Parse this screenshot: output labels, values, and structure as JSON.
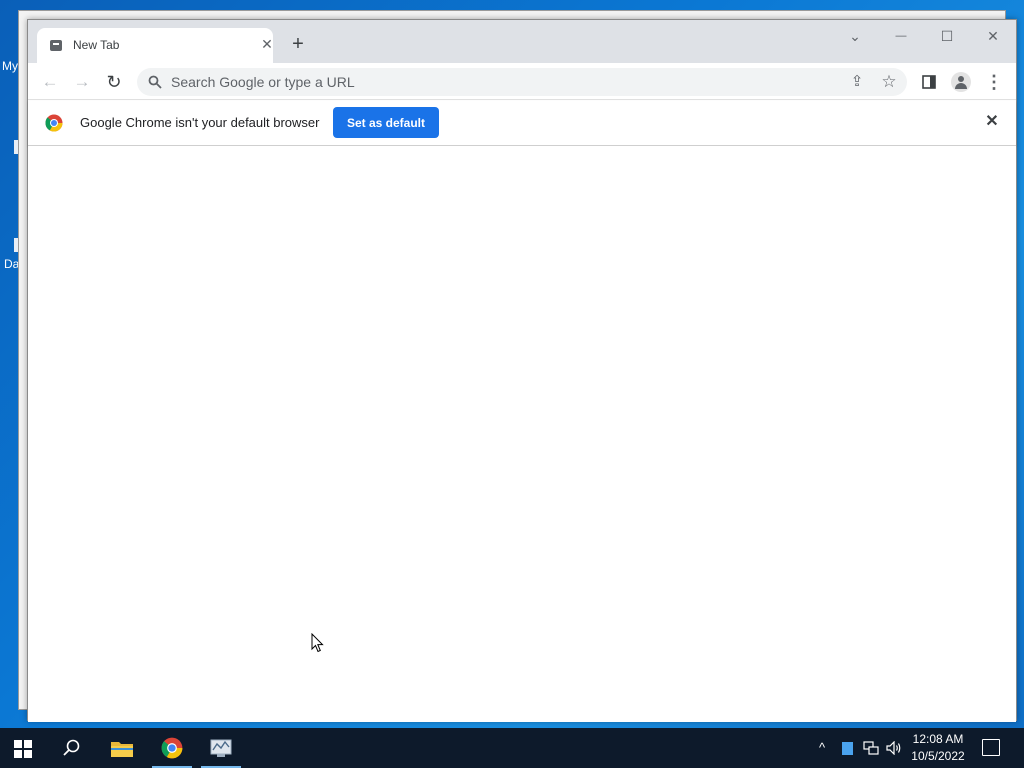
{
  "desktop": {
    "icon_labels": [
      "My",
      "Da"
    ]
  },
  "browser": {
    "tab": {
      "title": "New Tab",
      "close_icon": "close-icon"
    },
    "new_tab_label": "+",
    "window_controls": {
      "tab_search": "⌄",
      "minimize": "—",
      "maximize": "☐",
      "close": "✕"
    },
    "toolbar": {
      "back": "←",
      "forward": "→",
      "reload": "↻",
      "omnibox_placeholder": "Search Google or type a URL",
      "omnibox_value": "",
      "share": "⇪",
      "bookmark": "☆",
      "side_panel": "▮",
      "menu": "⋮"
    },
    "infobar": {
      "message": "Google Chrome isn't your default browser",
      "button_label": "Set as default",
      "close": "✕"
    }
  },
  "taskbar": {
    "apps": [
      "file-explorer",
      "google-chrome",
      "network-app"
    ],
    "tray": {
      "chevron": "^",
      "volume": "🔊"
    },
    "time": "12:08 AM",
    "date": "10/5/2022"
  },
  "colors": {
    "accent": "#1a73e8",
    "titlebar": "#dee1e6",
    "taskbar": "#0d1a2b",
    "desktop": "#0b78d4"
  }
}
